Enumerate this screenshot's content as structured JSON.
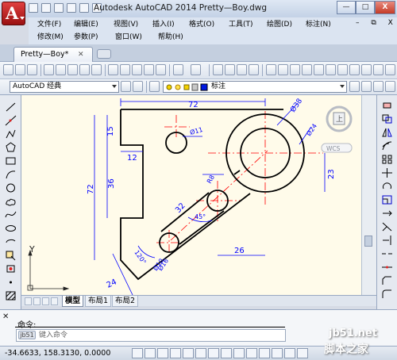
{
  "window": {
    "title": "Autodesk AutoCAD 2014     Pretty—Boy.dwg",
    "min": "—",
    "max": "□",
    "close": "X",
    "doc_controls": "– ⧉ X"
  },
  "app_button": {
    "letter": "A"
  },
  "menu": {
    "row1": [
      "文件(F)",
      "编辑(E)",
      "视图(V)",
      "插入(I)",
      "格式(O)",
      "工具(T)",
      "绘图(D)",
      "标注(N)"
    ],
    "row2": [
      "修改(M)",
      "参数(P)",
      "窗口(W)",
      "帮助(H)"
    ]
  },
  "tabs": {
    "document": "Pretty—Boy*",
    "close": "✕"
  },
  "toolbar": {
    "workspace": "AutoCAD 经典",
    "layer_name": "标注"
  },
  "viewcube": {
    "top_label": "上",
    "wcs": "WCS"
  },
  "layout_tabs": [
    "模型",
    "布局1",
    "布局2"
  ],
  "command": {
    "close": "✕",
    "prompt": "命令:",
    "pill": "jb51",
    "placeholder": "键入命令"
  },
  "status": {
    "coords": "-34.6633,  158.3130,  0.0000"
  },
  "watermark": {
    "line1": "jb51.net",
    "line2": "脚本之家"
  },
  "drawing": {
    "dims": [
      "72",
      "15",
      "12",
      "36",
      "72",
      "Ø11",
      "Ø38",
      "Ø24",
      "23",
      "32",
      "Ø16",
      "26",
      "R8",
      "45°",
      "120°",
      "Ø10",
      "24"
    ],
    "axis_y": "Y"
  },
  "colors": {
    "canvas": "#fffbea",
    "object_line": "#000000",
    "dimension": "#0000ff",
    "centerline": "#ff0000",
    "titlebar_accent": "#c0282a"
  }
}
